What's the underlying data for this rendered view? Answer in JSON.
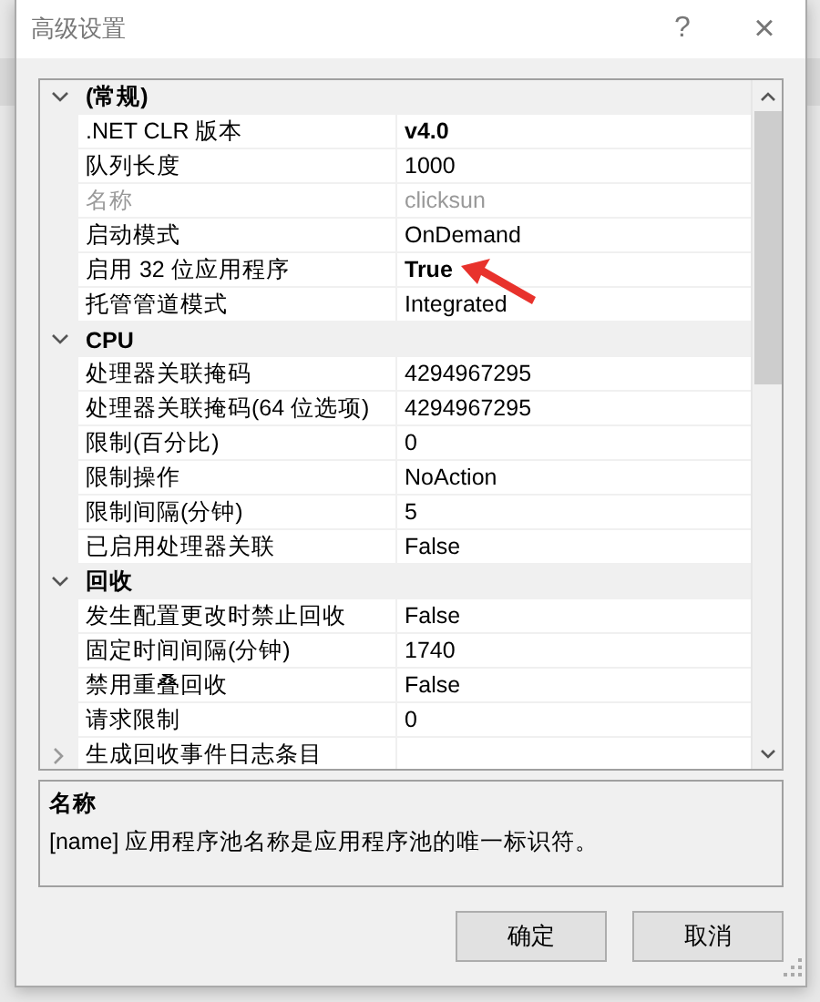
{
  "window": {
    "title": "高级设置",
    "help": "?",
    "close": "×"
  },
  "property_grid": {
    "categories": [
      {
        "name": "(常规)",
        "expanded": true,
        "items": [
          {
            "kind": "property",
            "name": ".NET CLR 版本",
            "value": "v4.0",
            "bold": true,
            "disabled": false
          },
          {
            "kind": "property",
            "name": "队列长度",
            "value": "1000",
            "bold": false,
            "disabled": false
          },
          {
            "kind": "property",
            "name": "名称",
            "value": "clicksun",
            "bold": false,
            "disabled": true
          },
          {
            "kind": "property",
            "name": "启动模式",
            "value": "OnDemand",
            "bold": false,
            "disabled": false
          },
          {
            "kind": "property",
            "name": "启用 32 位应用程序",
            "value": "True",
            "bold": true,
            "disabled": false
          },
          {
            "kind": "property",
            "name": "托管管道模式",
            "value": "Integrated",
            "bold": false,
            "disabled": false
          }
        ]
      },
      {
        "name": "CPU",
        "expanded": true,
        "items": [
          {
            "kind": "property",
            "name": "处理器关联掩码",
            "value": "4294967295",
            "bold": false,
            "disabled": false
          },
          {
            "kind": "property",
            "name": "处理器关联掩码(64 位选项)",
            "value": "4294967295",
            "bold": false,
            "disabled": false
          },
          {
            "kind": "property",
            "name": "限制(百分比)",
            "value": "0",
            "bold": false,
            "disabled": false
          },
          {
            "kind": "property",
            "name": "限制操作",
            "value": "NoAction",
            "bold": false,
            "disabled": false
          },
          {
            "kind": "property",
            "name": "限制间隔(分钟)",
            "value": "5",
            "bold": false,
            "disabled": false
          },
          {
            "kind": "property",
            "name": "已启用处理器关联",
            "value": "False",
            "bold": false,
            "disabled": false
          }
        ]
      },
      {
        "name": "回收",
        "expanded": true,
        "items": [
          {
            "kind": "property",
            "name": "发生配置更改时禁止回收",
            "value": "False",
            "bold": false,
            "disabled": false
          },
          {
            "kind": "property",
            "name": "固定时间间隔(分钟)",
            "value": "1740",
            "bold": false,
            "disabled": false
          },
          {
            "kind": "property",
            "name": "禁用重叠回收",
            "value": "False",
            "bold": false,
            "disabled": false
          },
          {
            "kind": "property",
            "name": "请求限制",
            "value": "0",
            "bold": false,
            "disabled": false
          },
          {
            "kind": "subgroup",
            "name": "生成回收事件日志条目",
            "expanded": false
          }
        ]
      }
    ]
  },
  "description": {
    "title": "名称",
    "text": "[name] 应用程序池名称是应用程序池的唯一标识符。"
  },
  "buttons": [
    "确定",
    "取消"
  ]
}
